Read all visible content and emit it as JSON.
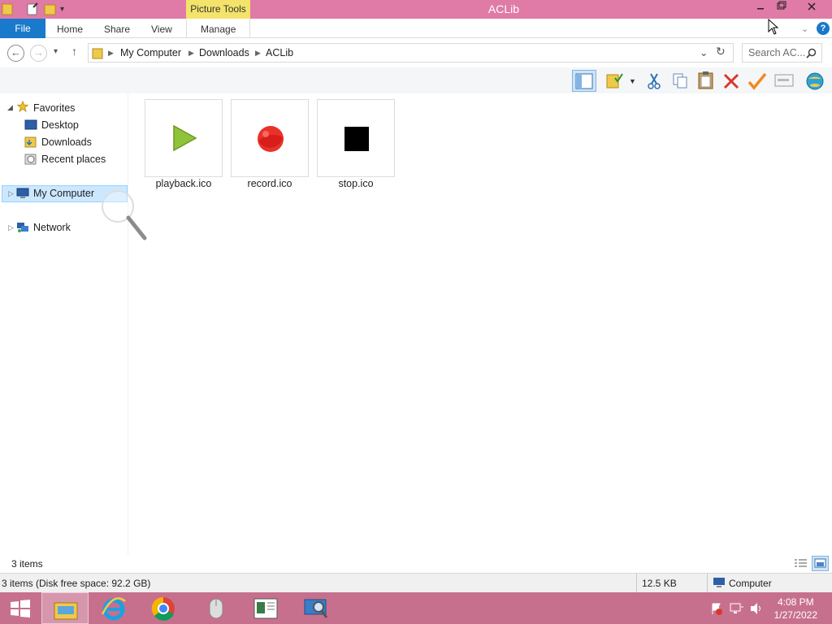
{
  "window": {
    "title": "ACLib",
    "contextual_tab_group": "Picture Tools",
    "minimize_icon": "minimize-icon",
    "restore_icon": "restore-icon",
    "close_icon": "close-icon"
  },
  "ribbon": {
    "tabs": [
      "File",
      "Home",
      "Share",
      "View",
      "Manage"
    ]
  },
  "address": {
    "path": [
      "My Computer",
      "Downloads",
      "ACLib"
    ],
    "search_placeholder": "Search AC..."
  },
  "nav": {
    "favorites": "Favorites",
    "items": [
      "Desktop",
      "Downloads",
      "Recent places"
    ],
    "my_computer": "My Computer",
    "network": "Network"
  },
  "files": [
    {
      "name": "playback.ico",
      "icon": "play-icon"
    },
    {
      "name": "record.ico",
      "icon": "record-icon"
    },
    {
      "name": "stop.ico",
      "icon": "stop-icon"
    }
  ],
  "status": {
    "item_count": "3 items",
    "disk_info": "3 items (Disk free space: 92.2 GB)",
    "size": "12.5 KB",
    "location": "Computer"
  },
  "taskbar": {
    "time": "4:08 PM",
    "date": "1/27/2022"
  },
  "colors": {
    "titlebar": "#e07aa6",
    "accent": "#1979ca",
    "taskbar": "#c7708e",
    "picture_tools": "#f3e36a"
  }
}
